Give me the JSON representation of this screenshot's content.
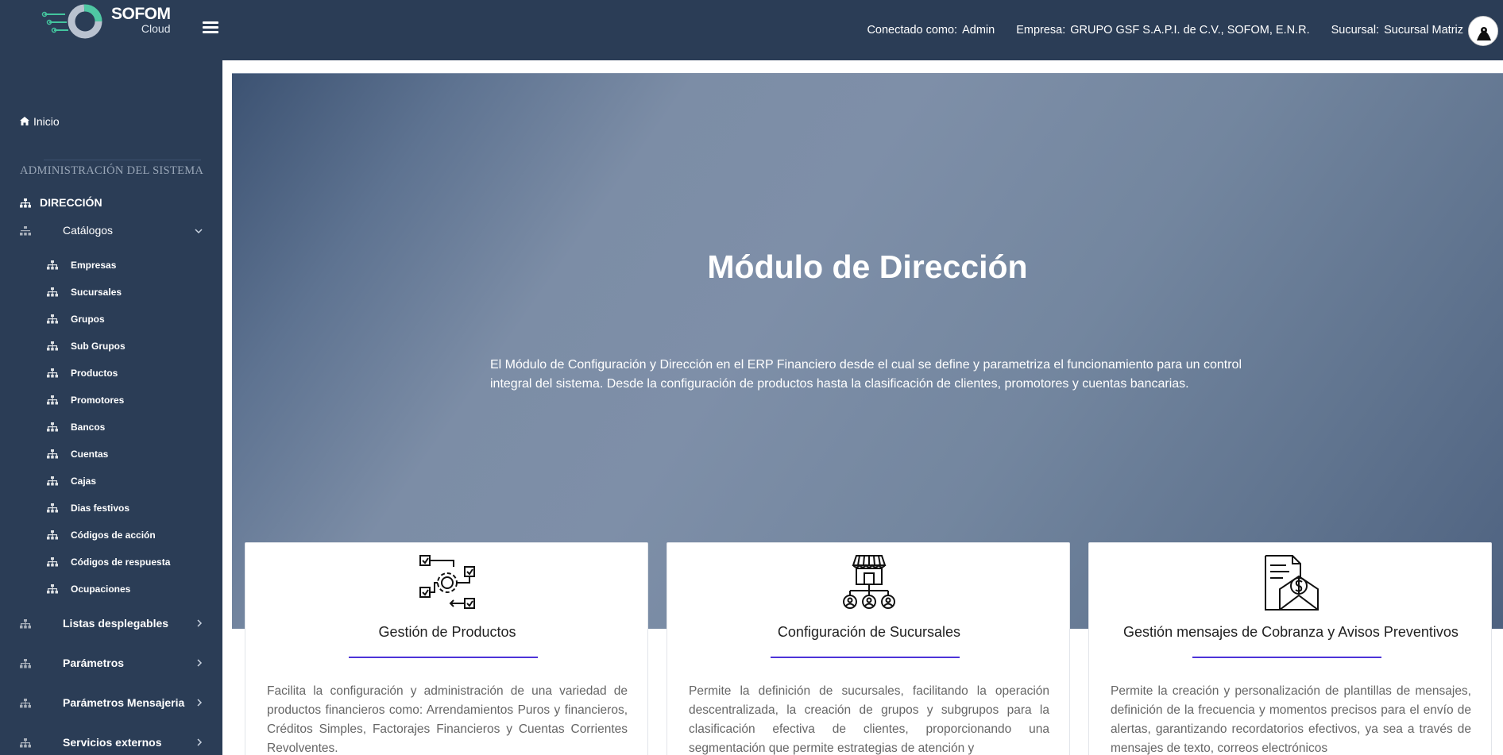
{
  "brand": {
    "name": "SOFOM",
    "sub": "Cloud"
  },
  "header": {
    "connected_label": "Conectado como:",
    "connected_value": "Admin",
    "company_label": "Empresa:",
    "company_value": "GRUPO GSF S.A.P.I. de C.V., SOFOM, E.N.R.",
    "branch_label": "Sucursal:",
    "branch_value": "Sucursal Matriz"
  },
  "sidebar": {
    "home": "Inicio",
    "heading": "ADMINISTRACIÓN DEL SISTEMA",
    "section": "DIRECCIÓN",
    "catalogs": "Catálogos",
    "catalog_items": [
      "Empresas",
      "Sucursales",
      "Grupos",
      "Sub Grupos",
      "Productos",
      "Promotores",
      "Bancos",
      "Cuentas",
      "Cajas",
      "Dias festivos",
      "Códigos de acción",
      "Códigos de respuesta",
      "Ocupaciones"
    ],
    "groups": [
      "Listas desplegables",
      "Parámetros",
      "Parámetros Mensajeria",
      "Servicios externos"
    ]
  },
  "hero": {
    "title": "Módulo de Dirección",
    "description": "El Módulo de Configuración y Dirección en el ERP Financiero desde el cual se define y parametriza el funcionamiento para un control integral del sistema. Desde la configuración de productos hasta la clasificación de clientes, promotores y cuentas bancarias."
  },
  "cards": [
    {
      "title": "Gestión de Productos",
      "icon": "settings-flow-icon",
      "text": "Facilita la configuración y administración de una variedad de productos financieros como: Arrendamientos Puros y financieros, Créditos Simples, Factorajes Financieros y Cuentas Corrientes Revolventes."
    },
    {
      "title": "Configuración de Sucursales",
      "icon": "store-network-icon",
      "text": "Permite la definición de sucursales, facilitando la operación descentralizada, la creación de grupos y subgrupos para la clasificación efectiva de clientes, proporcionando una segmentación que permite estrategias de atención y"
    },
    {
      "title": "Gestión mensajes de Cobranza y Avisos Preventivos",
      "icon": "invoice-envelope-icon",
      "text": "Permite la creación y personalización de plantillas de mensajes, definición de la frecuencia y momentos precisos para el envío de alertas, garantizando recordatorios efectivos, ya sea a través de mensajes de texto, correos electrónicos"
    }
  ],
  "colors": {
    "sidebar": "#2b3d56",
    "accent": "#4d34d8"
  }
}
